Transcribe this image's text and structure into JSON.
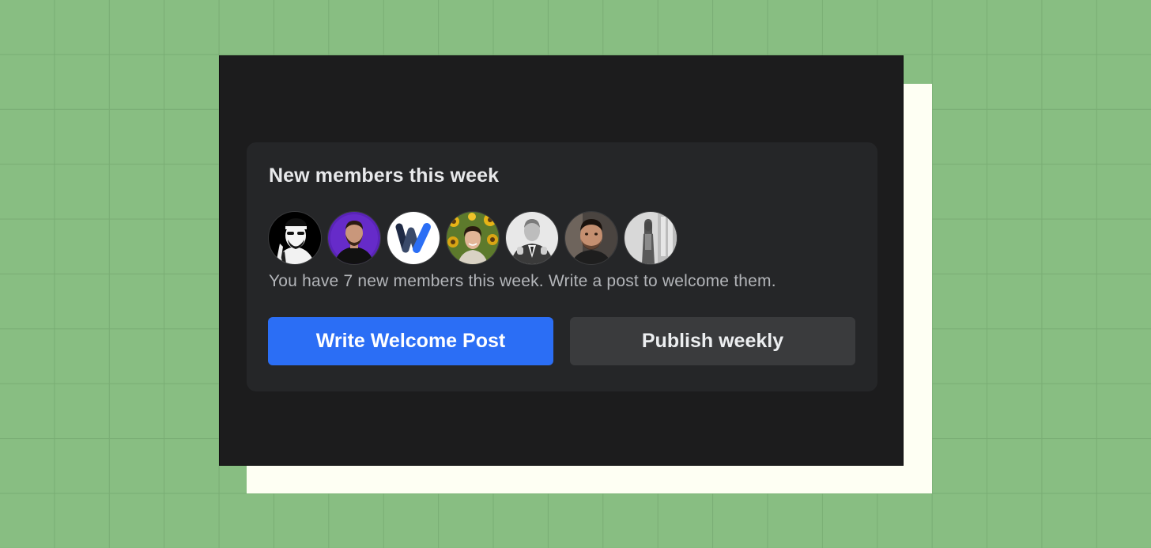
{
  "card": {
    "title": "New members this week",
    "description": "You have 7 new members this week. Write a post to welcome them.",
    "primary_button": "Write Welcome Post",
    "secondary_button": "Publish weekly"
  },
  "avatars": [
    {
      "name": "member-avatar-1",
      "style": "black-white-illustration"
    },
    {
      "name": "member-avatar-2",
      "style": "purple-background-photo"
    },
    {
      "name": "member-avatar-3",
      "style": "w-logo-blue"
    },
    {
      "name": "member-avatar-4",
      "style": "sunflower-photo"
    },
    {
      "name": "member-avatar-5",
      "style": "grayscale-photo"
    },
    {
      "name": "member-avatar-6",
      "style": "selfie-photo"
    },
    {
      "name": "member-avatar-7",
      "style": "grayscale-standing-photo"
    }
  ],
  "colors": {
    "page_background": "#88be82",
    "screen_background": "#1c1c1d",
    "card_background": "#252628",
    "primary_accent": "#2b6ef5",
    "secondary_button": "#3a3b3d"
  }
}
